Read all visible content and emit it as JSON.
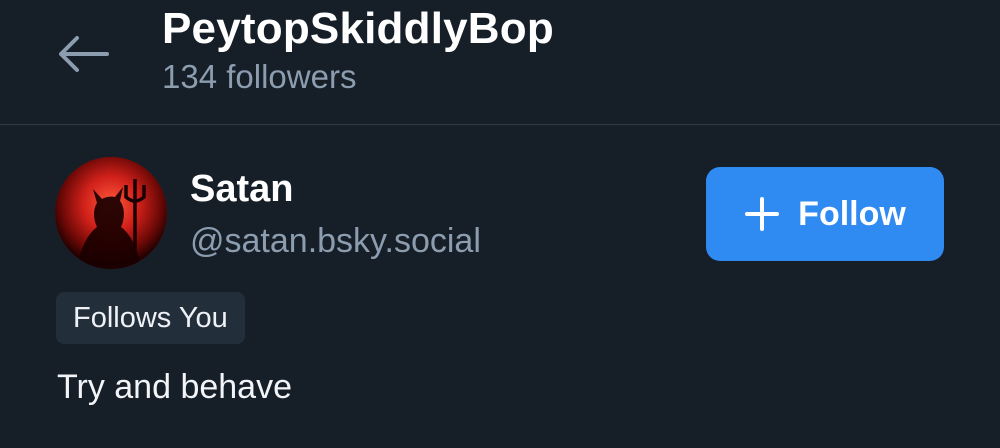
{
  "header": {
    "title": "PeytopSkiddlyBop",
    "subtitle": "134 followers",
    "back_icon": "arrow-left-icon"
  },
  "profile_card": {
    "display_name": "Satan",
    "handle": "@satan.bsky.social",
    "follow_button_label": "Follow",
    "follow_icon": "plus-icon",
    "badge": "Follows You",
    "bio": "Try and behave"
  },
  "colors": {
    "background": "#161e27",
    "accent": "#2f8bf2",
    "muted_text": "#8c9db0",
    "badge_background": "#232e3b",
    "divider": "#2e3a48"
  }
}
